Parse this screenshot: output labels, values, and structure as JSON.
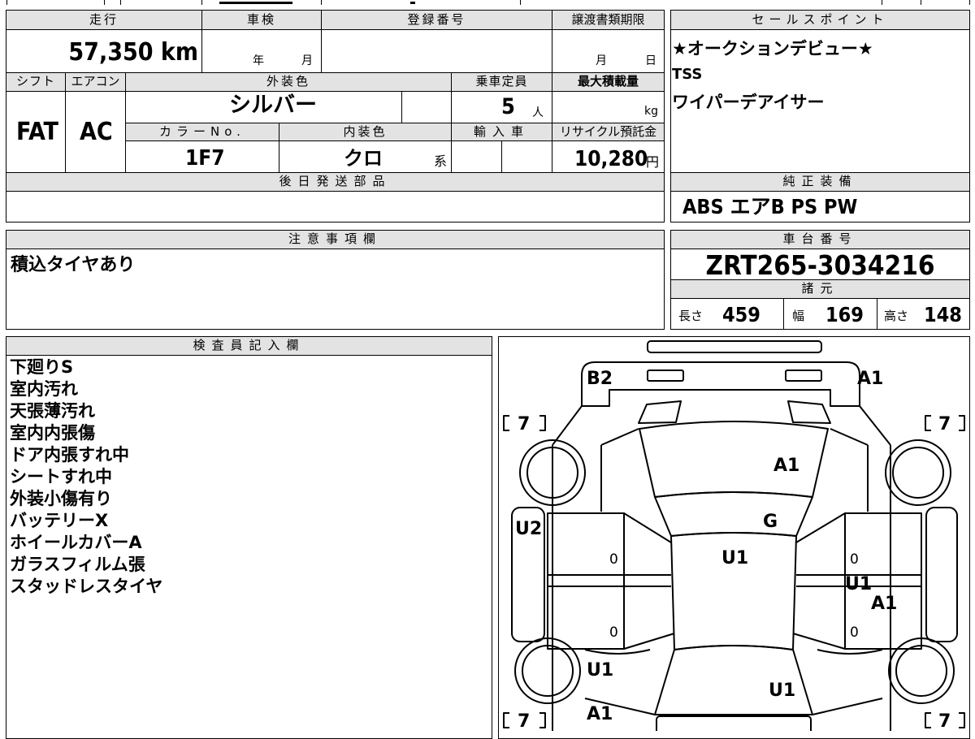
{
  "main": {
    "mileage_label": "走行",
    "mileage_value": "57,350 km",
    "inspection_label": "車検",
    "inspection_year_unit": "年",
    "inspection_month_unit": "月",
    "registration_label": "登録番号",
    "transfer_label": "譲渡書類期限",
    "transfer_month_unit": "月",
    "transfer_day_unit": "日",
    "shift_label": "シフト",
    "shift_value": "FAT",
    "ac_label": "エアコン",
    "ac_value": "AC",
    "exterior_color_label": "外装色",
    "exterior_color_value": "シルバー",
    "color_no_label": "カラーNo.",
    "color_no_value": "1F7",
    "interior_color_label": "内装色",
    "interior_color_value": "クロ",
    "interior_color_suffix": "系",
    "capacity_label": "乗車定員",
    "capacity_value": "5",
    "capacity_unit": "人",
    "max_load_label": "最大積載量",
    "max_load_unit": "kg",
    "import_label": "輸入車",
    "recycle_label": "リサイクル預託金",
    "recycle_value": "10,280",
    "recycle_unit": "円",
    "later_parts_label": "後日発送部品"
  },
  "sales": {
    "label": "セールスポイント",
    "lines": [
      "★オークションデビュー★",
      "TSS",
      "ワイパーデアイサー"
    ]
  },
  "equipment": {
    "label": "純正装備",
    "value": "ABS エアB PS PW"
  },
  "notes": {
    "label": "注意事項欄",
    "value": "積込タイヤあり"
  },
  "chassis": {
    "label": "車台番号",
    "value": "ZRT265-3034216",
    "specs_label": "諸元",
    "length_label": "長さ",
    "length_value": "459",
    "width_label": "幅",
    "width_value": "169",
    "height_label": "高さ",
    "height_value": "148"
  },
  "inspector": {
    "label": "検査員記入欄",
    "lines": [
      "下廻りS",
      "室内汚れ",
      "天張薄汚れ",
      "室内内張傷",
      "ドア内張すれ中",
      "シートすれ中",
      "外装小傷有り",
      "バッテリーX",
      "ホイールカバーA",
      "ガラスフィルム張",
      "スタッドレスタイヤ"
    ]
  },
  "diagram": {
    "marks": {
      "rear_left": "B2",
      "rear_right": "A1",
      "rear_window": "A1",
      "roof": "G",
      "cabin": "U1",
      "left_side": "U2",
      "right_door": "U1",
      "right_fender": "A1",
      "front_left_fender": "U1",
      "front_left_corner": "A1",
      "hood": "U1"
    },
    "tires": {
      "rear_left": "7",
      "rear_right": "7",
      "front_left": "7",
      "front_right": "7"
    },
    "zero_marks": [
      "0",
      "0",
      "0",
      "0"
    ]
  },
  "colors": {
    "header_bg": "#e3e3e3",
    "line": "#000000"
  }
}
